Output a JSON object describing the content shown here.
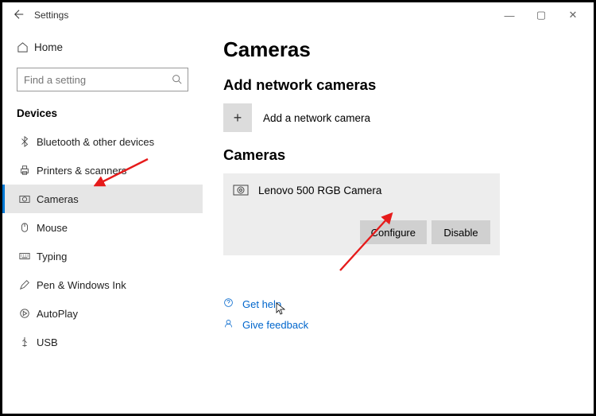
{
  "window": {
    "title": "Settings"
  },
  "sidebar": {
    "home": "Home",
    "search_placeholder": "Find a setting",
    "category": "Devices",
    "items": [
      {
        "label": "Bluetooth & other devices"
      },
      {
        "label": "Printers & scanners"
      },
      {
        "label": "Cameras"
      },
      {
        "label": "Mouse"
      },
      {
        "label": "Typing"
      },
      {
        "label": "Pen & Windows Ink"
      },
      {
        "label": "AutoPlay"
      },
      {
        "label": "USB"
      }
    ]
  },
  "main": {
    "title": "Cameras",
    "add_section": "Add network cameras",
    "add_label": "Add a network camera",
    "cameras_section": "Cameras",
    "selected_camera": "Lenovo 500 RGB Camera",
    "btn_configure": "Configure",
    "btn_disable": "Disable",
    "help": "Get help",
    "feedback": "Give feedback"
  }
}
